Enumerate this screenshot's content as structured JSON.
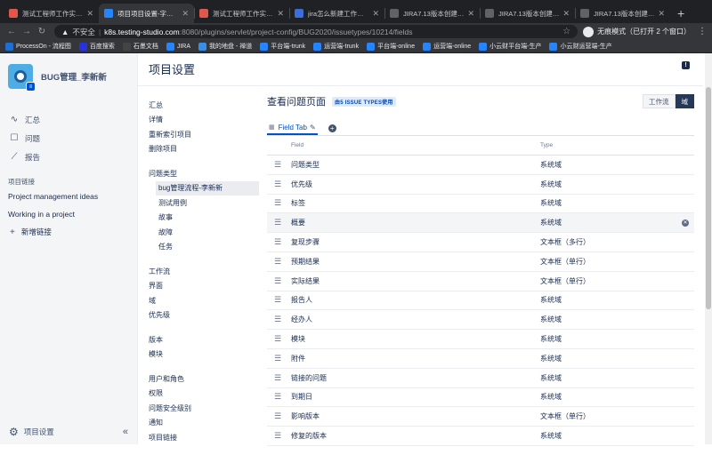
{
  "browser": {
    "tabs": [
      {
        "title": "测试工程师工作实战测试",
        "color": "#e2574c",
        "active": false
      },
      {
        "title": "项目项目设置-字段为(BU",
        "color": "#2684ff",
        "active": true
      },
      {
        "title": "测试工程师工作实战一测",
        "color": "#e2574c",
        "active": false
      },
      {
        "title": "jira怎么新建工作流_百度",
        "color": "#3b6ed8",
        "active": false
      },
      {
        "title": "JIRA7.13版本创建项目",
        "color": "#5f6368",
        "active": false
      },
      {
        "title": "JIRA7.13版本创建项目",
        "color": "#5f6368",
        "active": false
      },
      {
        "title": "JIRA7.13版本创建项目",
        "color": "#5f6368",
        "active": false
      }
    ],
    "new_tab": "+",
    "address": {
      "insecure_label": "不安全",
      "host": "k8s.testing-studio.com",
      "path": ":8080/plugins/servlet/project-config/BUG2020/issuetypes/10214/fields"
    },
    "incognito_label": "无痕模式（已打开 2 个窗口）",
    "bookmarks": [
      {
        "label": "ProcessOn - 流程图",
        "color": "#1f6fd1"
      },
      {
        "label": "百度搜索",
        "color": "#2932e1"
      },
      {
        "label": "石墨文档",
        "color": "#444444"
      },
      {
        "label": "JIRA",
        "color": "#2684ff"
      },
      {
        "label": "我的地盘 - 禅道",
        "color": "#3a8ee6"
      },
      {
        "label": "平台端-trunk",
        "color": "#2684ff"
      },
      {
        "label": "运营端-trunk",
        "color": "#2684ff"
      },
      {
        "label": "平台端-online",
        "color": "#2684ff"
      },
      {
        "label": "运营端-online",
        "color": "#2684ff"
      },
      {
        "label": "小云财平台端-生产",
        "color": "#2684ff"
      },
      {
        "label": "小云财运营端-生产",
        "color": "#2684ff"
      }
    ]
  },
  "sidebar": {
    "project_name": "BUG管理_李新新",
    "nav": [
      {
        "label": "汇总",
        "icon": "pulse-icon"
      },
      {
        "label": "问题",
        "icon": "issues-icon"
      },
      {
        "label": "报告",
        "icon": "chart-icon"
      }
    ],
    "links_header": "项目链接",
    "links": [
      "Project management ideas",
      "Working in a project"
    ],
    "add_link": "新增链接",
    "settings": "项目设置",
    "collapse": "«"
  },
  "page": {
    "title": "项目设置",
    "subnav": [
      {
        "items": [
          {
            "label": "汇总"
          },
          {
            "label": "详情"
          },
          {
            "label": "重新索引项目"
          },
          {
            "label": "删除项目"
          }
        ]
      },
      {
        "items": [
          {
            "label": "问题类型"
          },
          {
            "label": "bug管理流程-李新新",
            "child": true,
            "selected": true
          },
          {
            "label": "测试用例",
            "child": true
          },
          {
            "label": "故事",
            "child": true
          },
          {
            "label": "故障",
            "child": true
          },
          {
            "label": "任务",
            "child": true
          }
        ]
      },
      {
        "items": [
          {
            "label": "工作流"
          },
          {
            "label": "界面"
          },
          {
            "label": "域"
          },
          {
            "label": "优先级"
          }
        ]
      },
      {
        "items": [
          {
            "label": "版本"
          },
          {
            "label": "模块"
          }
        ]
      },
      {
        "items": [
          {
            "label": "用户和角色"
          },
          {
            "label": "权限"
          },
          {
            "label": "问题安全级别"
          },
          {
            "label": "通知"
          },
          {
            "label": "项目链接"
          }
        ]
      }
    ],
    "content": {
      "title": "查看问题页面",
      "lozenge": "由5 ISSUE TYPES使用",
      "buttons": [
        {
          "label": "工作流",
          "active": false
        },
        {
          "label": "域",
          "active": true
        }
      ],
      "tab_label": "Field Tab",
      "columns": {
        "field": "Field",
        "type": "Type"
      },
      "rows": [
        {
          "field": "问题类型",
          "type": "系统域"
        },
        {
          "field": "优先级",
          "type": "系统域"
        },
        {
          "field": "标签",
          "type": "系统域"
        },
        {
          "field": "概要",
          "type": "系统域",
          "hover": true
        },
        {
          "field": "复现步骤",
          "type": "文本框（多行）"
        },
        {
          "field": "预期结果",
          "type": "文本框（单行）"
        },
        {
          "field": "实际结果",
          "type": "文本框（单行）"
        },
        {
          "field": "报告人",
          "type": "系统域"
        },
        {
          "field": "经办人",
          "type": "系统域"
        },
        {
          "field": "模块",
          "type": "系统域"
        },
        {
          "field": "附件",
          "type": "系统域"
        },
        {
          "field": "链接的问题",
          "type": "系统域"
        },
        {
          "field": "到期日",
          "type": "系统域"
        },
        {
          "field": "影响版本",
          "type": "文本框（单行）"
        },
        {
          "field": "修复的版本",
          "type": "系统域"
        }
      ]
    }
  }
}
